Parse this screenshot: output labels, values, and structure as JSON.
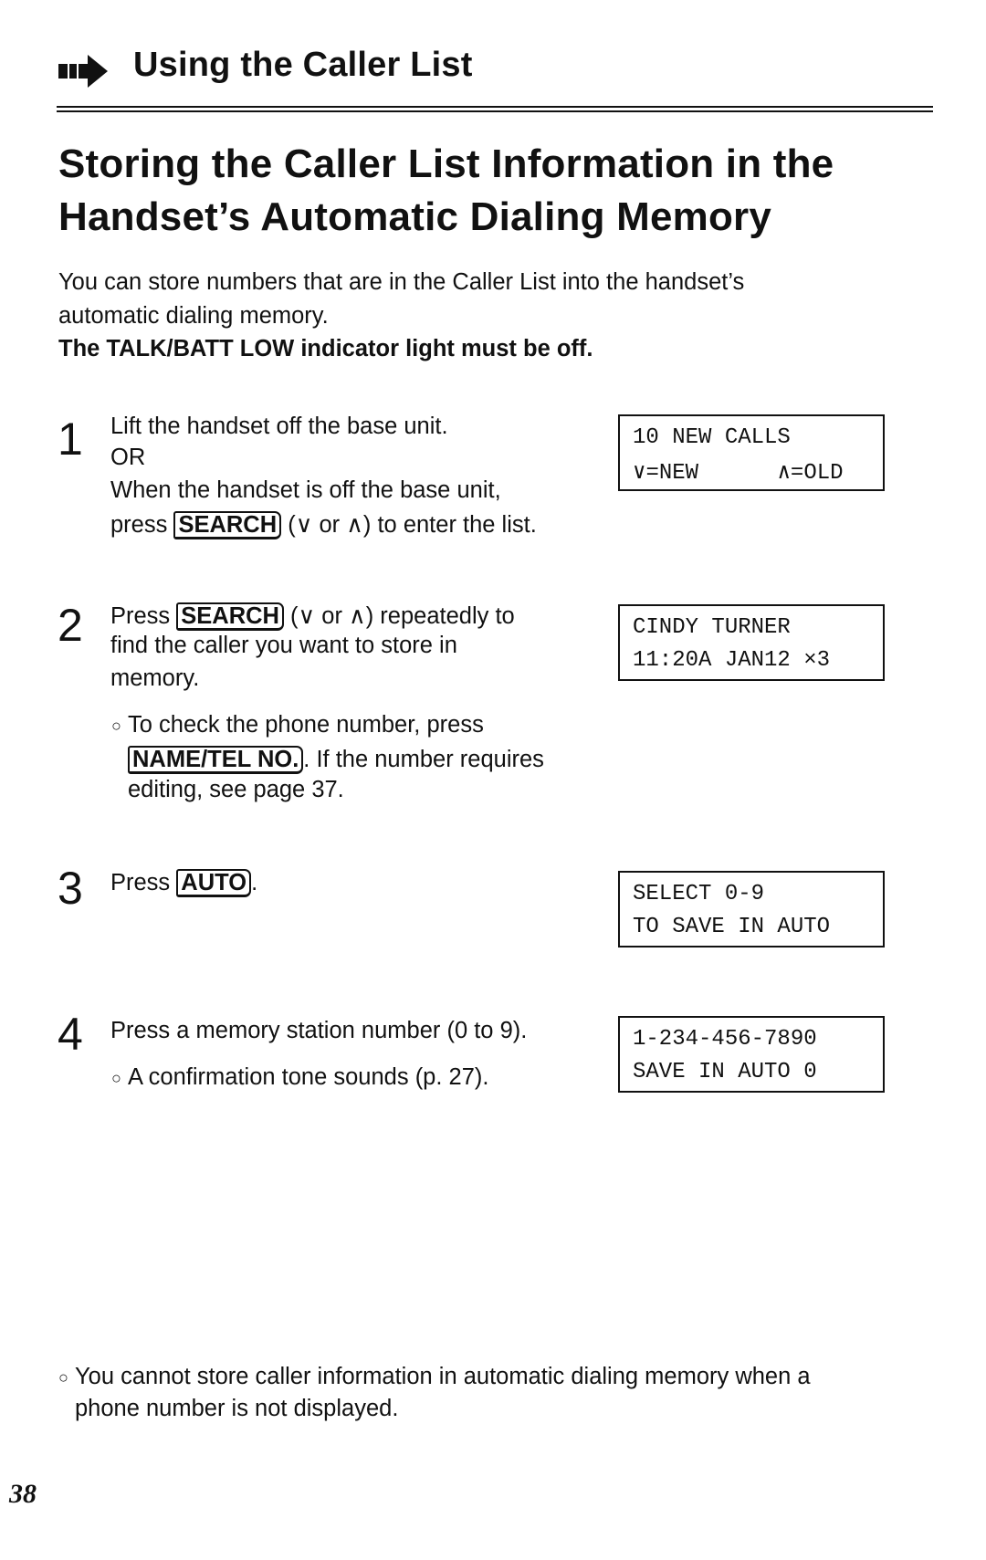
{
  "header": {
    "section_title": "Using the Caller List",
    "icon": "arrow-right-icon"
  },
  "title": {
    "line1": "Storing the Caller List Information in the",
    "line2": "Handset’s Automatic Dialing Memory"
  },
  "intro": {
    "line1": "You can store numbers that are in the Caller List into the handset’s",
    "line2": "automatic dialing memory.",
    "note": "The TALK/BATT LOW indicator light must be off."
  },
  "steps": [
    {
      "number": "1",
      "lines": [
        [
          {
            "t": "Lift the handset off the base unit."
          }
        ],
        [
          {
            "t": "OR"
          }
        ],
        [
          {
            "t": "When the handset is off the base unit,"
          }
        ],
        [
          {
            "t": "press "
          },
          {
            "t": "SEARCH",
            "key": true
          },
          {
            "t": " (∨ or ∧) to enter the list."
          }
        ]
      ],
      "bullets": [],
      "lcd": [
        "10 NEW CALLS",
        "∨=NEW      ∧=OLD"
      ]
    },
    {
      "number": "2",
      "lines": [
        [
          {
            "t": "Press "
          },
          {
            "t": "SEARCH",
            "key": true
          },
          {
            "t": " (∨ or ∧) repeatedly to"
          }
        ],
        [
          {
            "t": "find the caller you want to store in"
          }
        ],
        [
          {
            "t": "memory."
          }
        ]
      ],
      "bullets": [
        [
          [
            {
              "t": "To check the phone number, press"
            }
          ],
          [
            {
              "t": "NAME/TEL NO.",
              "key": true
            },
            {
              "t": ". If the number requires"
            }
          ],
          [
            {
              "t": "editing, see page 37."
            }
          ]
        ]
      ],
      "lcd": [
        "CINDY TURNER",
        "11:20A JAN12 ×3"
      ]
    },
    {
      "number": "3",
      "lines": [
        [
          {
            "t": "Press "
          },
          {
            "t": "AUTO",
            "key": true
          },
          {
            "t": "."
          }
        ]
      ],
      "bullets": [],
      "lcd": [
        "SELECT 0-9",
        "TO SAVE IN AUTO"
      ]
    },
    {
      "number": "4",
      "lines": [
        [
          {
            "t": "Press a memory station number (0 to 9)."
          }
        ]
      ],
      "bullets": [
        [
          [
            {
              "t": "A confirmation tone sounds (p. 27)."
            }
          ]
        ]
      ],
      "lcd": [
        "1-234-456-7890",
        "SAVE IN AUTO 0"
      ]
    }
  ],
  "footnote": {
    "line1": "You cannot store caller information in automatic dialing memory when a",
    "line2": "phone number is not displayed."
  },
  "page_number": "38"
}
